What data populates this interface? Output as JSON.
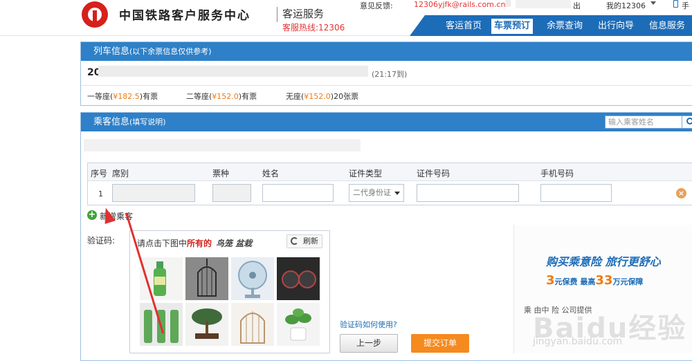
{
  "header": {
    "site_name": "中国铁路客户服务中心",
    "sub_name": "客运服务",
    "hotline": "客服热线:12306",
    "feedback_label": "意见反馈:",
    "feedback_email": "12306yjfk@rails.com.cn",
    "logout_text": "出",
    "my_account": "我的12306",
    "mobile_label": "手"
  },
  "nav": {
    "items": [
      "客运首页",
      "车票预订",
      "余票查询",
      "出行向导",
      "信息服务"
    ],
    "active": "车票预订"
  },
  "train_panel": {
    "title": "列车信息",
    "note": "(以下余票信息仅供参考)",
    "train_no_prefix": "20",
    "arrival": "(21:17到)",
    "seats": [
      {
        "name": "一等座",
        "price": "¥182.5",
        "status": "有票"
      },
      {
        "name": "二等座",
        "price": "¥152.0",
        "status": "有票"
      },
      {
        "name": "无座",
        "price": "¥152.0",
        "status": "20张票"
      }
    ]
  },
  "passenger_panel": {
    "title": "乘客信息",
    "note": "(填写说明)",
    "search_placeholder": "输入乘客姓名",
    "columns": [
      "序号",
      "席别",
      "票种",
      "姓名",
      "证件类型",
      "证件号码",
      "手机号码"
    ],
    "row": {
      "no": "1",
      "id_type": "二代身份证"
    },
    "add_passenger": "新增乘客"
  },
  "captcha": {
    "label": "验证码:",
    "prompt_prefix": "请点击下图中",
    "prompt_bold": "所有的",
    "target_word": "鸟笼 盆栽",
    "refresh": "刷新",
    "help": "验证码如何使用?"
  },
  "buttons": {
    "prev": "上一步",
    "submit": "提交订单"
  },
  "insurance": {
    "title": "购买乘意险 旅行更舒心",
    "premium_num": "3",
    "premium_text": "元保费",
    "max_text": "最高",
    "max_num": "33",
    "coverage_text": "万元保障",
    "provider": "乘 由中 险 公司提供"
  },
  "watermark": {
    "brand": "Baidu经验",
    "url": "jingyan.baidu.com"
  }
}
